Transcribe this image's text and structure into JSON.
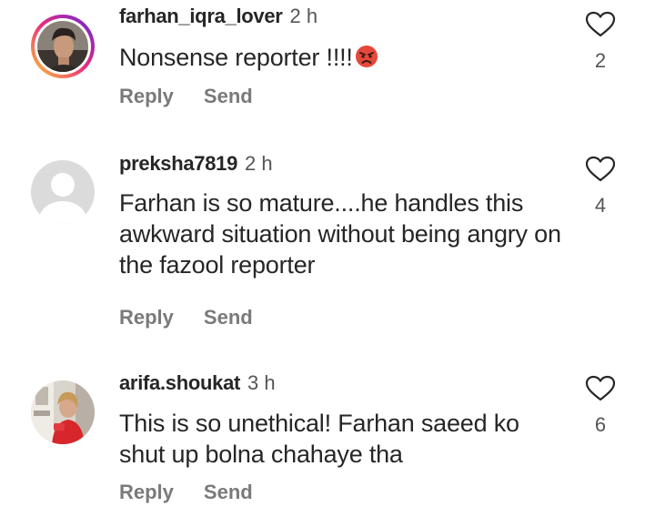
{
  "comments": [
    {
      "username": "farhan_iqra_lover",
      "time": "2 h",
      "text": "Nonsense reporter !!!!",
      "emoji": "angry-face-emoji",
      "likes": "2",
      "reply_label": "Reply",
      "send_label": "Send"
    },
    {
      "username": "preksha7819",
      "time": "2 h",
      "text": "Farhan is so mature....he handles this awkward situation without being angry on the fazool reporter",
      "likes": "4",
      "reply_label": "Reply",
      "send_label": "Send"
    },
    {
      "username": "arifa.shoukat",
      "time": "3 h",
      "text": "This is so unethical! Farhan saeed ko shut up bolna chahaye tha",
      "likes": "6",
      "reply_label": "Reply",
      "send_label": "Send"
    }
  ],
  "colors": {
    "story_ring_start": "#f9ce34",
    "story_ring_mid": "#ee2a7b",
    "story_ring_end": "#6228d7",
    "action_text": "#7a7a7a",
    "heart_outline": "#262626"
  },
  "icons": {
    "like": "heart-outline-icon",
    "default_avatar": "default-avatar-icon"
  }
}
